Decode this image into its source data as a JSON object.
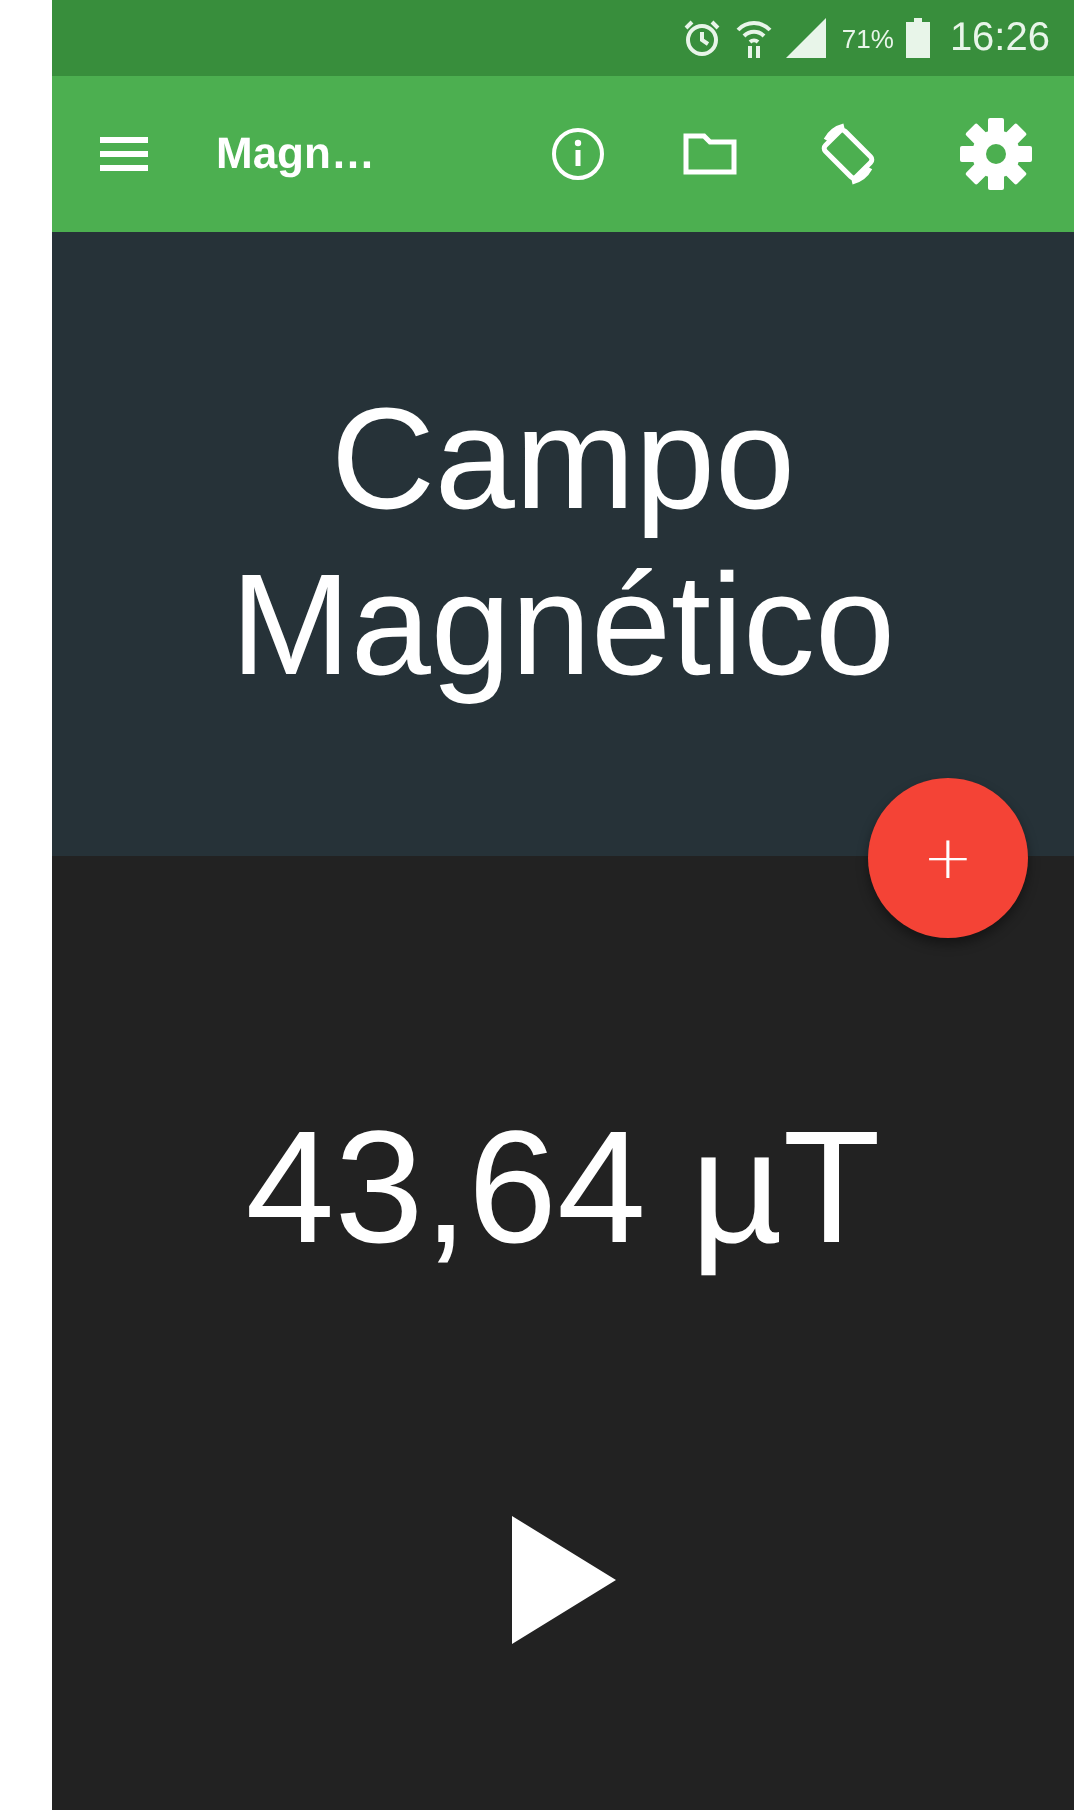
{
  "status_bar": {
    "battery": "71%",
    "time": "16:26"
  },
  "toolbar": {
    "title": "Magn…"
  },
  "header": {
    "title": "Campo Magnético"
  },
  "fab": {
    "label": "+"
  },
  "reading": {
    "value": "43,64 µT"
  }
}
